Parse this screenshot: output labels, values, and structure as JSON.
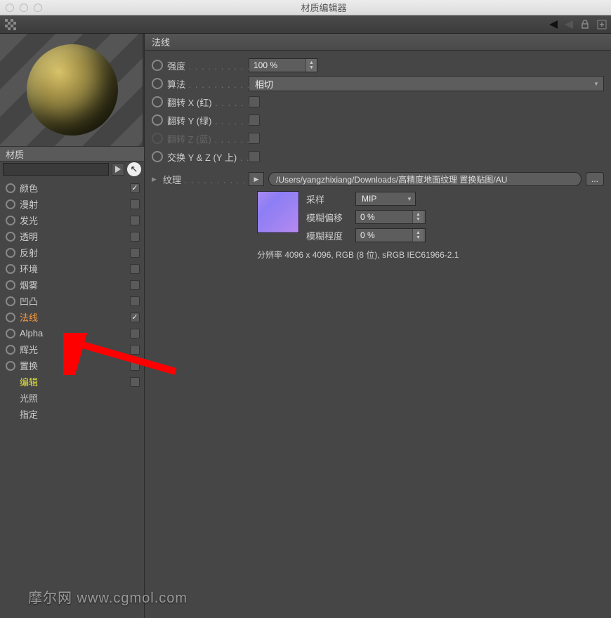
{
  "window": {
    "title": "材质编辑器"
  },
  "material": {
    "name": "材质"
  },
  "channels": [
    {
      "label": "颜色",
      "checked": true,
      "ring": true
    },
    {
      "label": "漫射",
      "checked": false,
      "ring": true
    },
    {
      "label": "发光",
      "checked": false,
      "ring": true
    },
    {
      "label": "透明",
      "checked": false,
      "ring": true
    },
    {
      "label": "反射",
      "checked": false,
      "ring": true
    },
    {
      "label": "环境",
      "checked": false,
      "ring": true
    },
    {
      "label": "烟雾",
      "checked": false,
      "ring": true
    },
    {
      "label": "凹凸",
      "checked": false,
      "ring": true
    },
    {
      "label": "法线",
      "checked": true,
      "ring": true,
      "active": true
    },
    {
      "label": "Alpha",
      "checked": false,
      "ring": true
    },
    {
      "label": "辉光",
      "checked": false,
      "ring": true
    },
    {
      "label": "置换",
      "checked": false,
      "ring": true
    },
    {
      "label": "编辑",
      "checked": false,
      "ring": false,
      "edit": true
    },
    {
      "label": "光照",
      "checked": false,
      "ring": false,
      "nocb": true
    },
    {
      "label": "指定",
      "checked": false,
      "ring": false,
      "nocb": true
    }
  ],
  "section": {
    "title": "法线"
  },
  "props": {
    "strength": {
      "label": "强度",
      "value": "100 %"
    },
    "algorithm": {
      "label": "算法",
      "value": "相切"
    },
    "flipx": {
      "label": "翻转 X (红)"
    },
    "flipy": {
      "label": "翻转 Y (绿)"
    },
    "flipz": {
      "label": "翻转 Z (蓝)"
    },
    "swapyz": {
      "label": "交换 Y & Z (Y 上)"
    }
  },
  "texture": {
    "label": "纹理",
    "path": "/Users/yangzhixiang/Downloads/高精度地面纹理 置换贴图/AU",
    "sampling": {
      "label": "采样",
      "value": "MIP"
    },
    "bluroffset": {
      "label": "模糊偏移",
      "value": "0 %"
    },
    "blurscale": {
      "label": "模糊程度",
      "value": "0 %"
    },
    "resolution": "分辨率 4096 x 4096, RGB (8 位), sRGB IEC61966-2.1"
  },
  "watermark": "摩尔网 www.cgmol.com"
}
